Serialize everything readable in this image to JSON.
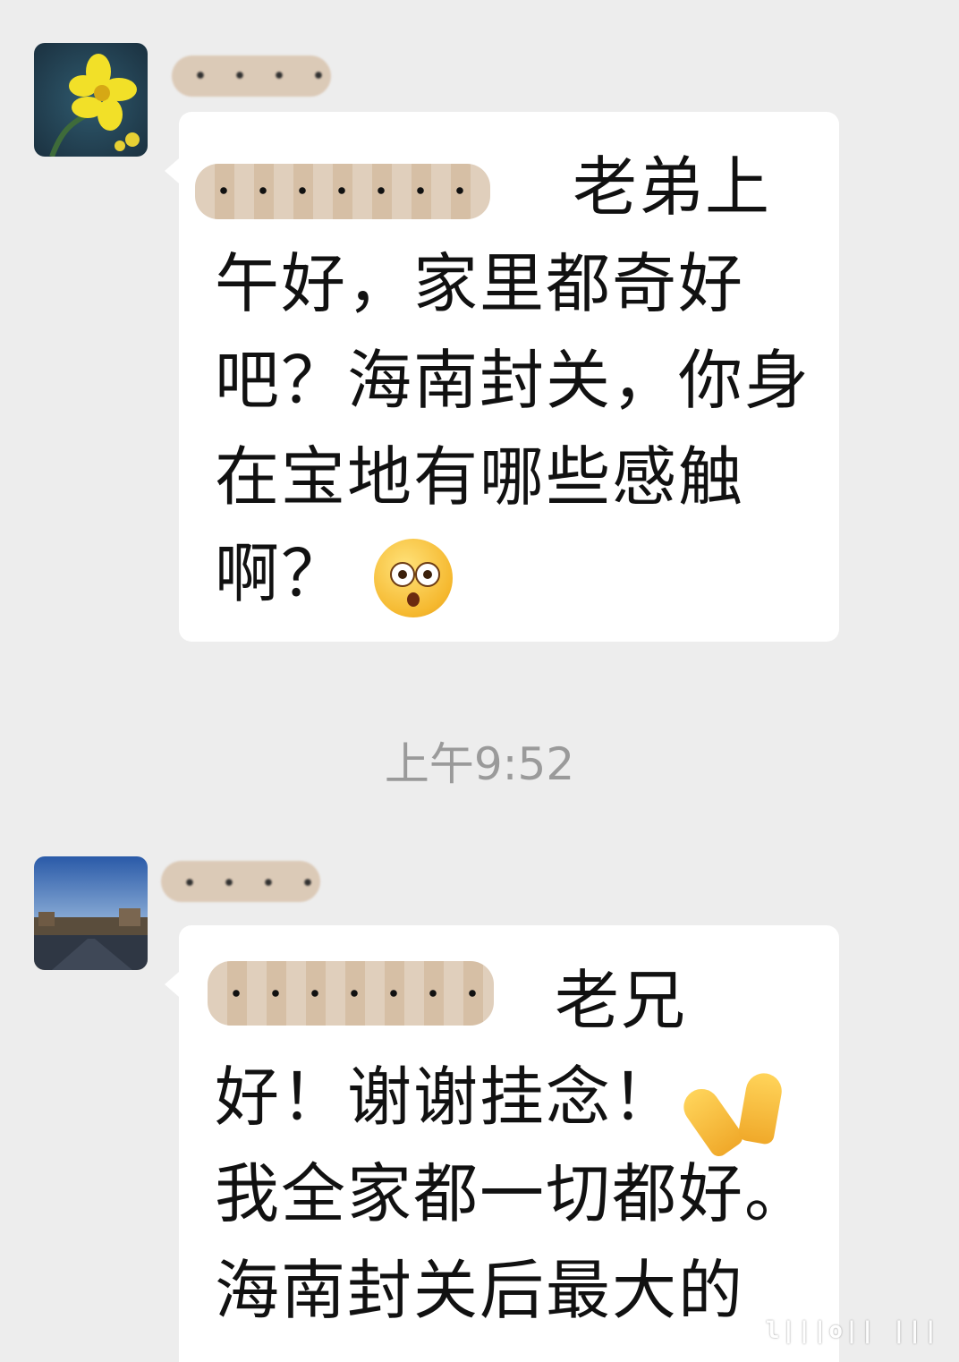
{
  "messages": [
    {
      "avatar": "flower-avatar",
      "redacted_name": true,
      "text_line1": "老弟上",
      "text_rest": "午好，家里都奇好吧？海南封关，你身在宝地有哪些感触啊？",
      "emoji": "flushed-face"
    },
    {
      "avatar": "landscape-avatar",
      "redacted_name": true,
      "text_line1": "老兄",
      "text_line2": "好！谢谢挂念！",
      "text_rest": "我全家都一切都好。海南封关后最大的",
      "emoji": "folded-hands"
    }
  ],
  "timestamp": "上午9:52"
}
